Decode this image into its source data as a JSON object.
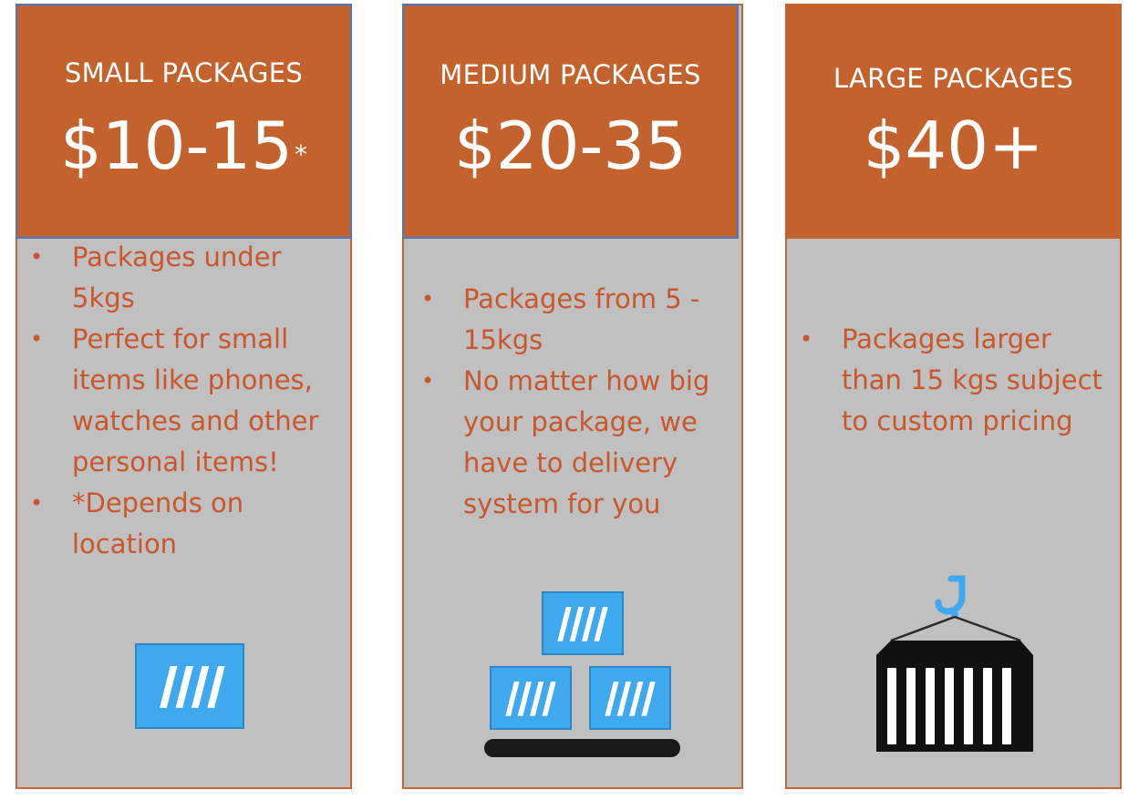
{
  "cards": {
    "small": {
      "title": "SMALL PACKAGES",
      "price": "$10-15",
      "price_mark": "*",
      "bullets": [
        "Packages under 5kgs",
        "Perfect for small items like phones, watches and other personal items!",
        "*Depends on location"
      ],
      "icon": "single-crate-icon"
    },
    "medium": {
      "title": "MEDIUM PACKAGES",
      "price": "$20-35",
      "bullets": [
        "Packages from 5 - 15kgs",
        "No matter how big your package, we have to delivery system for you"
      ],
      "icon": "stacked-crates-icon"
    },
    "large": {
      "title": "LARGE PACKAGES",
      "price": "$40+",
      "bullets": [
        "Packages larger than 15 kgs subject to custom pricing"
      ],
      "icon": "crane-container-icon"
    }
  },
  "colors": {
    "header_fill": "#c4622e",
    "body_fill": "#c0c0c0",
    "bullet_text": "#c9572b",
    "crate_blue": "#3fa9f0",
    "container_black": "#111111"
  }
}
